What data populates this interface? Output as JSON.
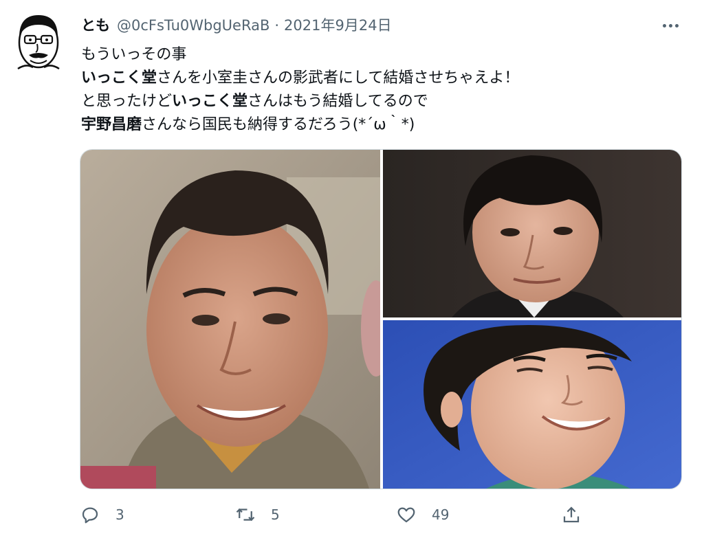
{
  "tweet": {
    "author": {
      "display_name": "とも",
      "handle": "@0cFsTu0WbgUeRaB",
      "avatar_icon": "caricature-face-avatar"
    },
    "separator": "·",
    "date": "2021年9月24日",
    "more_icon": "more-horizontal-icon",
    "lines": [
      [
        {
          "text": "もういっその事",
          "bold": false
        }
      ],
      [
        {
          "text": "いっこく堂",
          "bold": true
        },
        {
          "text": "さんを小室圭さんの影武者にして結婚させちゃえよ！",
          "bold": false
        }
      ],
      [
        {
          "text": "と思ったけど",
          "bold": false
        },
        {
          "text": "いっこく堂",
          "bold": true
        },
        {
          "text": "さんはもう結婚してるので",
          "bold": false
        }
      ],
      [
        {
          "text": "宇野昌磨",
          "bold": true
        },
        {
          "text": "さんなら国民も納得するだろう(*´ω｀*)",
          "bold": false
        }
      ]
    ],
    "media": [
      {
        "id": "photo-1",
        "description_icon": "portrait-photo"
      },
      {
        "id": "photo-2",
        "description_icon": "portrait-photo"
      },
      {
        "id": "photo-3",
        "description_icon": "portrait-photo"
      }
    ],
    "actions": {
      "reply": {
        "icon": "reply-icon",
        "count": "3"
      },
      "retweet": {
        "icon": "retweet-icon",
        "count": "5"
      },
      "like": {
        "icon": "heart-icon",
        "count": "49"
      },
      "share": {
        "icon": "share-icon",
        "count": ""
      }
    }
  },
  "colors": {
    "text_primary": "#0f1419",
    "text_secondary": "#536471",
    "border": "#cfd9de"
  }
}
